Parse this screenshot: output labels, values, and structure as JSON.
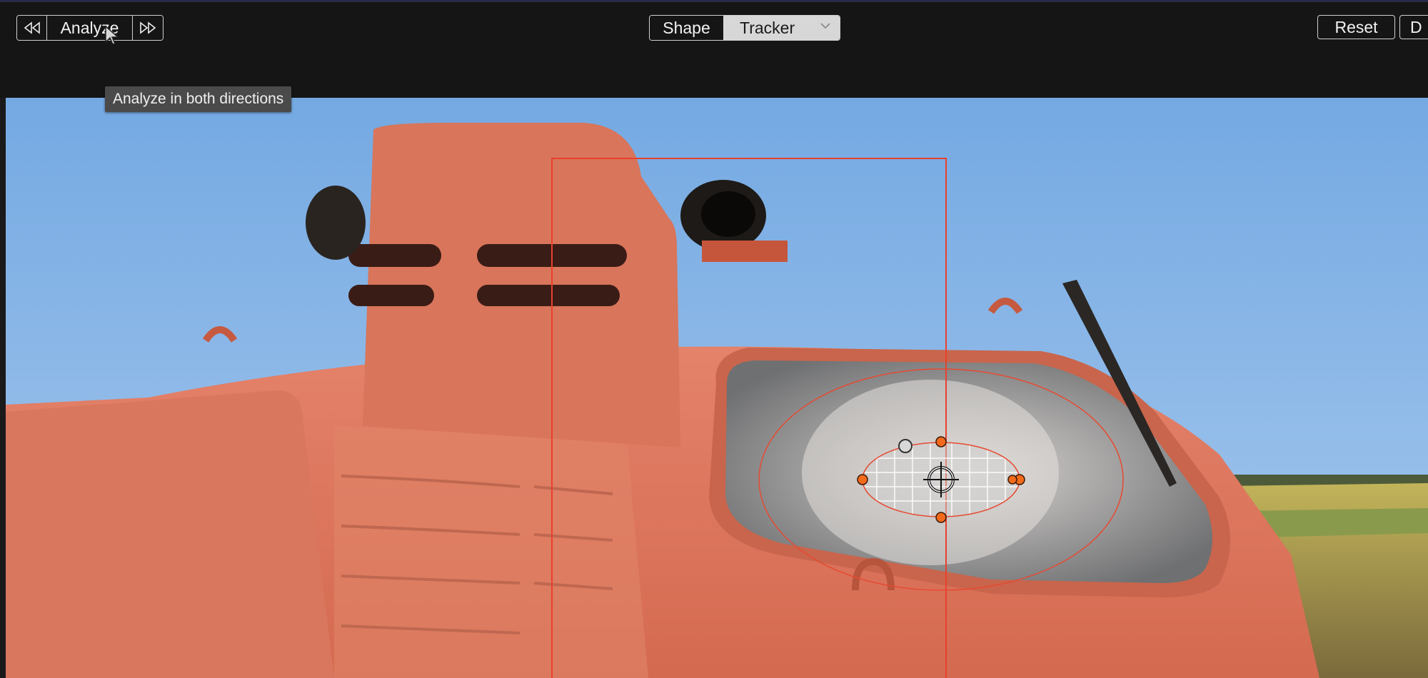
{
  "toolbar": {
    "analyze_label": "Analyze",
    "analyze_back_icon": "rewind-icon",
    "analyze_forward_icon": "fast-forward-icon",
    "mode_shape_label": "Shape",
    "mode_tracker_label": "Tracker",
    "tracker_chevron_icon": "chevron-down-icon",
    "reset_label": "Reset",
    "next_button_partial": "D"
  },
  "tooltip": {
    "text": "Analyze in both directions"
  },
  "colors": {
    "background": "#151515",
    "tracker_segment_bg": "#d7d7d7",
    "tracking_box": "#e8402c",
    "control_point": "#f26a1b",
    "sky": "#7fb2e6",
    "locomotive": "#e07a5e"
  },
  "viewer": {
    "content": "locomotive-cab-video-frame"
  }
}
